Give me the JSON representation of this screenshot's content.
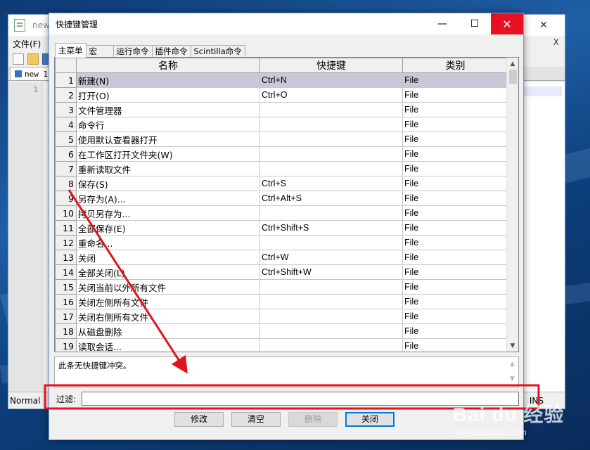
{
  "background_app": {
    "tab_title": "new",
    "menu_file": "文件(F)",
    "menu_close_x": "X",
    "doc_tab": "new 1",
    "line_number": "1",
    "status_mode": "Normal",
    "status_ins": "INS"
  },
  "dialog": {
    "title": "快捷键管理",
    "window_buttons": {
      "minimize": "—",
      "maximize": "☐",
      "close": "✕"
    },
    "tabs": [
      {
        "label": "主菜单",
        "active": true
      },
      {
        "label": "宏",
        "active": false
      },
      {
        "label": "运行命令",
        "active": false
      },
      {
        "label": "插件命令",
        "active": false
      },
      {
        "label": "Scintilla命令",
        "active": false
      }
    ],
    "columns": {
      "name": "名称",
      "shortcut": "快捷键",
      "category": "类别"
    },
    "rows": [
      {
        "num": "1",
        "name": "新建(N)",
        "shortcut": "Ctrl+N",
        "category": "File"
      },
      {
        "num": "2",
        "name": "打开(O)",
        "shortcut": "Ctrl+O",
        "category": "File"
      },
      {
        "num": "3",
        "name": "文件管理器",
        "shortcut": "",
        "category": "File"
      },
      {
        "num": "4",
        "name": "命令行",
        "shortcut": "",
        "category": "File"
      },
      {
        "num": "5",
        "name": "使用默认查看器打开",
        "shortcut": "",
        "category": "File"
      },
      {
        "num": "6",
        "name": "在工作区打开文件夹(W)",
        "shortcut": "",
        "category": "File"
      },
      {
        "num": "7",
        "name": "重新读取文件",
        "shortcut": "",
        "category": "File"
      },
      {
        "num": "8",
        "name": "保存(S)",
        "shortcut": "Ctrl+S",
        "category": "File"
      },
      {
        "num": "9",
        "name": "另存为(A)...",
        "shortcut": "Ctrl+Alt+S",
        "category": "File"
      },
      {
        "num": "10",
        "name": "拷贝另存为...",
        "shortcut": "",
        "category": "File"
      },
      {
        "num": "11",
        "name": "全部保存(E)",
        "shortcut": "Ctrl+Shift+S",
        "category": "File"
      },
      {
        "num": "12",
        "name": "重命名...",
        "shortcut": "",
        "category": "File"
      },
      {
        "num": "13",
        "name": "关闭",
        "shortcut": "Ctrl+W",
        "category": "File"
      },
      {
        "num": "14",
        "name": "全部关闭(L)",
        "shortcut": "Ctrl+Shift+W",
        "category": "File"
      },
      {
        "num": "15",
        "name": "关闭当前以外所有文件",
        "shortcut": "",
        "category": "File"
      },
      {
        "num": "16",
        "name": "关闭左侧所有文件",
        "shortcut": "",
        "category": "File"
      },
      {
        "num": "17",
        "name": "关闭右侧所有文件",
        "shortcut": "",
        "category": "File"
      },
      {
        "num": "18",
        "name": "从磁盘删除",
        "shortcut": "",
        "category": "File"
      },
      {
        "num": "19",
        "name": "读取会话...",
        "shortcut": "",
        "category": "File"
      }
    ],
    "conflict_message": "此条无快捷键冲突。",
    "filter_label": "过滤:",
    "filter_value": "",
    "buttons": {
      "modify": "修改",
      "clear": "清空",
      "delete": "删除",
      "close": "关闭"
    }
  },
  "annotation": {
    "highlight_color": "#e0141e",
    "arrow_color": "#e0141e"
  },
  "watermark": {
    "line1": "Bai du 经验",
    "line2": "jingyan.baidu.com"
  }
}
